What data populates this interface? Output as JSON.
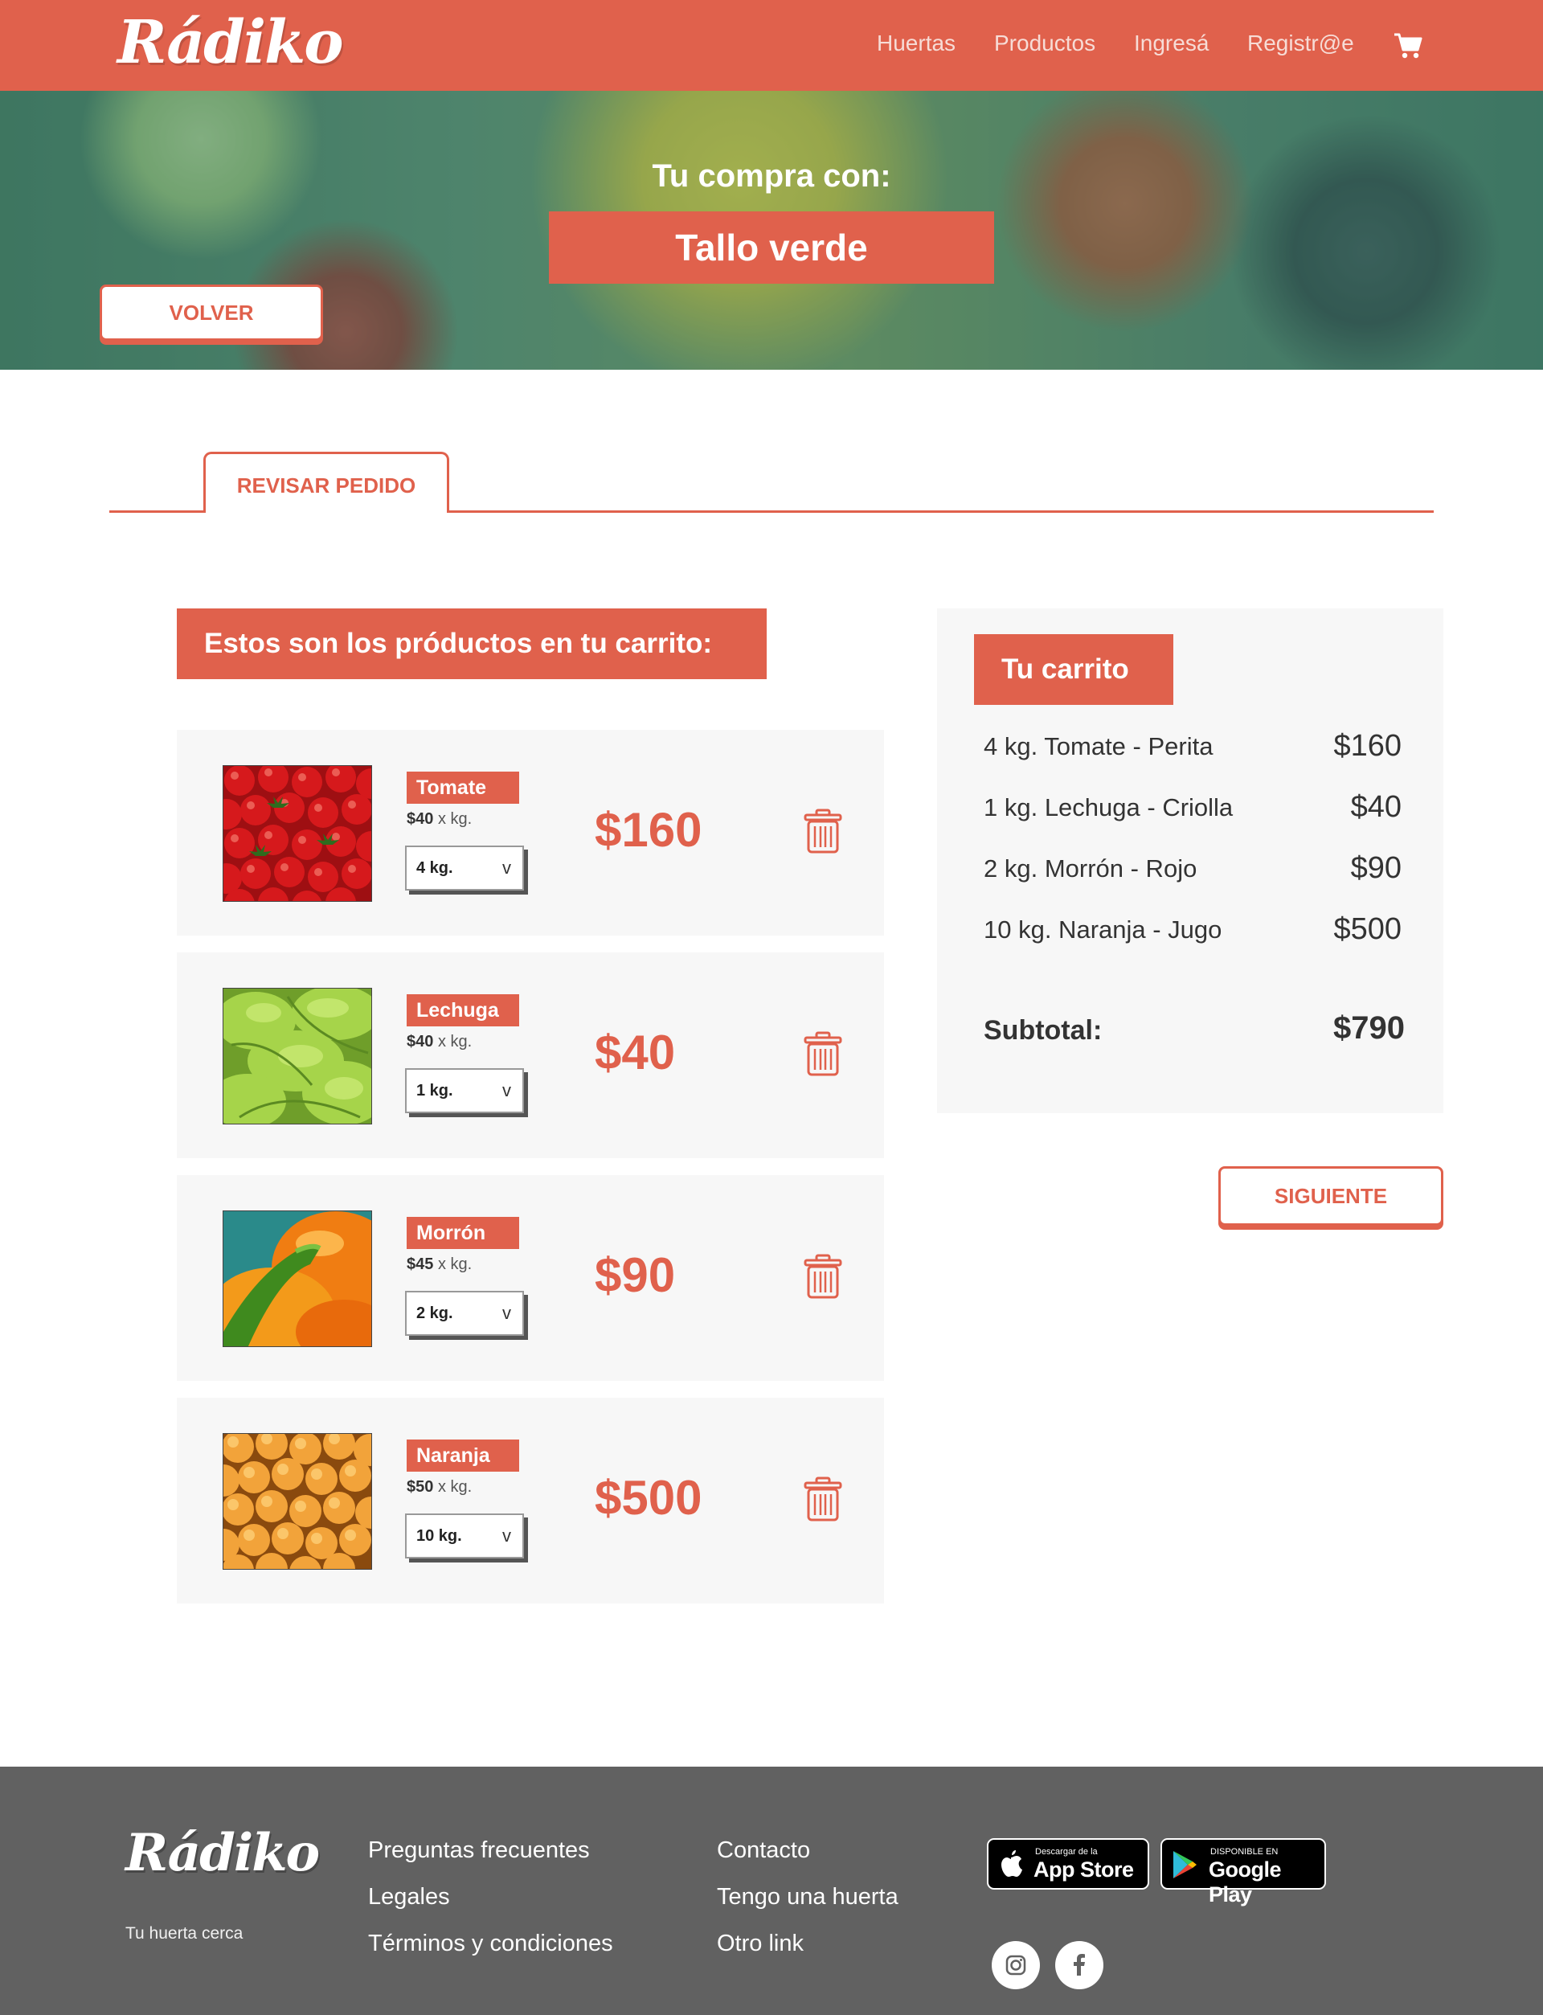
{
  "header": {
    "logo": "Rádiko",
    "nav": [
      "Huertas",
      "Productos",
      "Ingresá",
      "Registr@e"
    ]
  },
  "hero": {
    "subtitle": "Tu compra con:",
    "store_name": "Tallo verde",
    "back_button": "VOLVER"
  },
  "tabs": {
    "active": "REVISAR PEDIDO"
  },
  "products": {
    "heading": "Estos son los próductos en tu carrito:",
    "unit_suffix": "x kg.",
    "items": [
      {
        "name": "Tomate",
        "unit_price": "$40",
        "qty": "4 kg.",
        "total": "$160"
      },
      {
        "name": "Lechuga",
        "unit_price": "$40",
        "qty": "1 kg.",
        "total": "$40"
      },
      {
        "name": "Morrón",
        "unit_price": "$45",
        "qty": "2 kg.",
        "total": "$90"
      },
      {
        "name": "Naranja",
        "unit_price": "$50",
        "qty": "10 kg.",
        "total": "$500"
      }
    ]
  },
  "summary": {
    "title": "Tu carrito",
    "rows": [
      {
        "desc": "4 kg.  Tomate - Perita",
        "amount": "$160"
      },
      {
        "desc": "1 kg.  Lechuga - Criolla",
        "amount": "$40"
      },
      {
        "desc": "2 kg.  Morrón - Rojo",
        "amount": "$90"
      },
      {
        "desc": "10 kg.  Naranja - Jugo",
        "amount": "$500"
      }
    ],
    "subtotal_label": "Subtotal:",
    "subtotal_value": "$790",
    "next_button": "SIGUIENTE"
  },
  "footer": {
    "logo": "Rádiko",
    "tagline": "Tu huerta cerca",
    "col1": [
      "Preguntas frecuentes",
      "Legales",
      "Términos y condiciones"
    ],
    "col2": [
      "Contacto",
      "Tengo una huerta",
      "Otro link"
    ],
    "app_store": {
      "small": "Descargar de la",
      "big": "App Store"
    },
    "google_play": {
      "small": "DISPONIBLE EN",
      "big": "Google Play"
    }
  },
  "colors": {
    "accent": "#e0614c",
    "footer_bg": "#616161",
    "card_bg": "#f7f7f7"
  }
}
